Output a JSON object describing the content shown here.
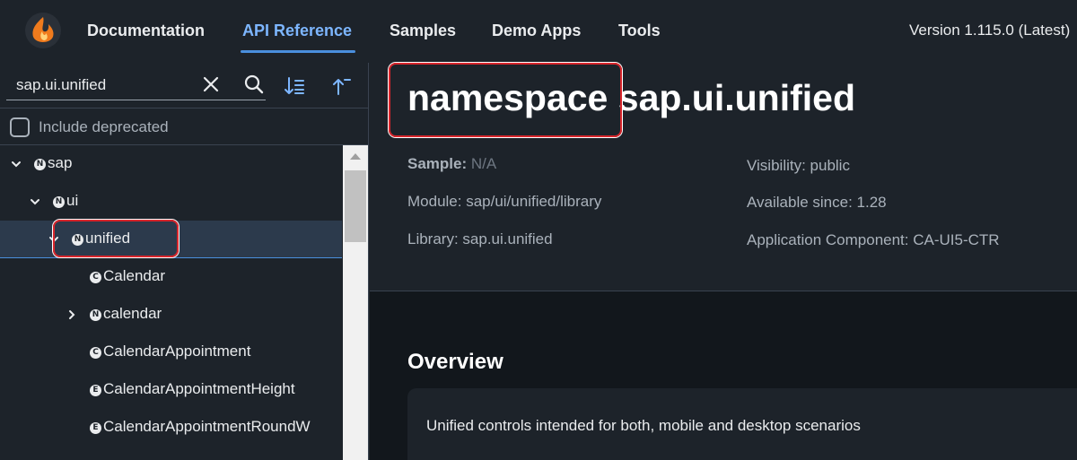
{
  "header": {
    "nav": [
      {
        "label": "Documentation"
      },
      {
        "label": "API Reference"
      },
      {
        "label": "Samples"
      },
      {
        "label": "Demo Apps"
      },
      {
        "label": "Tools"
      }
    ],
    "version": "Version 1.115.0 (Latest)"
  },
  "sidebar": {
    "search_value": "sap.ui.unified",
    "include_deprecated_label": "Include deprecated",
    "tree": [
      {
        "label": "sap",
        "badge": "N",
        "expanded": true
      },
      {
        "label": "ui",
        "badge": "N",
        "expanded": true
      },
      {
        "label": "unified",
        "badge": "N",
        "expanded": true,
        "selected": true
      },
      {
        "label": "Calendar",
        "badge": "C"
      },
      {
        "label": "calendar",
        "badge": "N",
        "expanded": false
      },
      {
        "label": "CalendarAppointment",
        "badge": "C"
      },
      {
        "label": "CalendarAppointmentHeight",
        "badge": "E"
      },
      {
        "label": "CalendarAppointmentRoundW",
        "badge": "E"
      }
    ]
  },
  "main": {
    "title_kind": "namespace",
    "title_name": "sap.ui.unified",
    "sample_label": "Sample:",
    "sample_value": "N/A",
    "module": "Module: sap/ui/unified/library",
    "library": "Library: sap.ui.unified",
    "visibility": "Visibility: public",
    "available_since": "Available since: 1.28",
    "app_component": "Application Component: CA-UI5-CTR",
    "overview_title": "Overview",
    "overview_text": "Unified controls intended for both, mobile and desktop scenarios"
  },
  "colors": {
    "background": "#1d232a",
    "accent": "#7db6ff",
    "highlight": "#d9262c"
  }
}
